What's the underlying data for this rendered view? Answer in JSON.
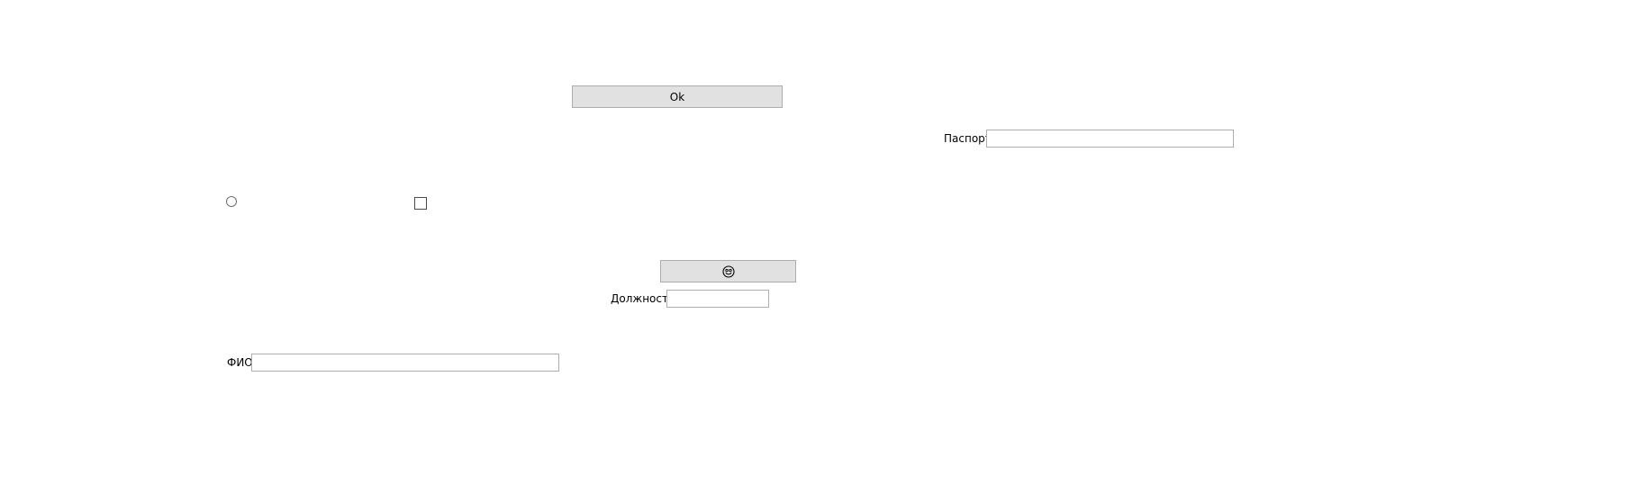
{
  "ok_button": {
    "label": "Ok"
  },
  "passport": {
    "label": "Паспорт",
    "value": ""
  },
  "position": {
    "label": "Должность",
    "value": ""
  },
  "fio": {
    "label": "ФИО",
    "value": ""
  },
  "radio": {
    "checked": false
  },
  "checkbox": {
    "checked": false
  },
  "icon_button": {
    "icon": "smiley-face-icon"
  }
}
